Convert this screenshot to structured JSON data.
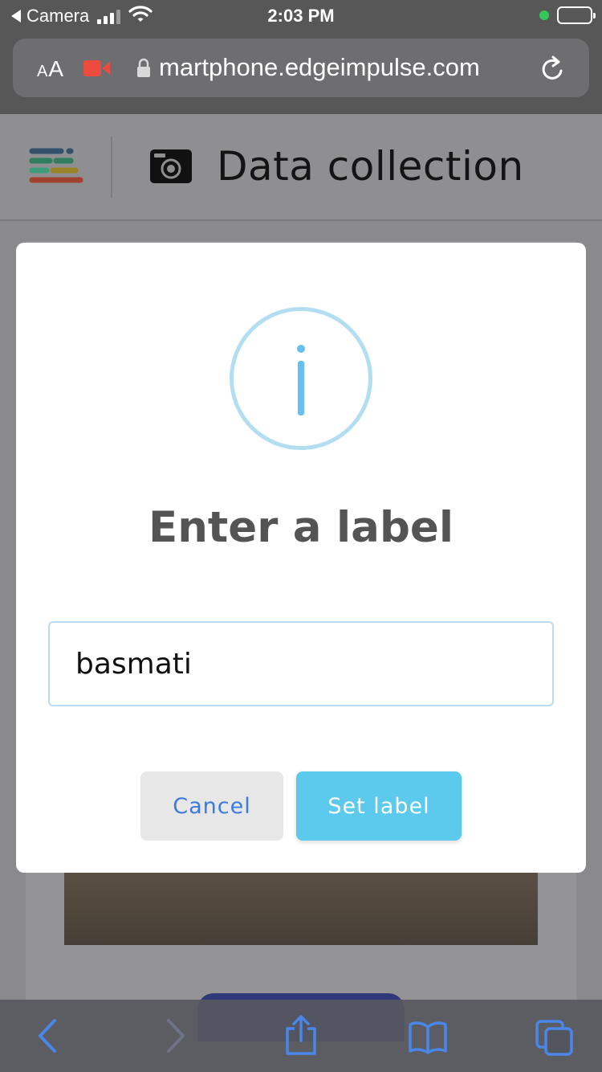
{
  "status_bar": {
    "back_app": "Camera",
    "time": "2:03 PM"
  },
  "browser": {
    "text_size_label_small": "A",
    "text_size_label_large": "A",
    "url": "martphone.edgeimpulse.com"
  },
  "header": {
    "title": "Data collection"
  },
  "modal": {
    "title": "Enter a label",
    "input_value": "basmati",
    "cancel_label": "Cancel",
    "set_label": "Set label"
  },
  "colors": {
    "accent": "#5ccaec",
    "cancel_text": "#3b7ae0",
    "info_icon": "#66bff2",
    "toolbar_icon": "#4a86e8"
  },
  "icons": {
    "menu": "menu-logo-icon",
    "camera": "camera-icon",
    "info": "info-icon",
    "lock": "lock-icon",
    "reload": "reload-icon",
    "record": "screen-recording-icon",
    "toolbar": [
      "back-arrow-icon",
      "forward-arrow-icon",
      "share-icon",
      "bookmarks-icon",
      "tabs-icon"
    ]
  }
}
